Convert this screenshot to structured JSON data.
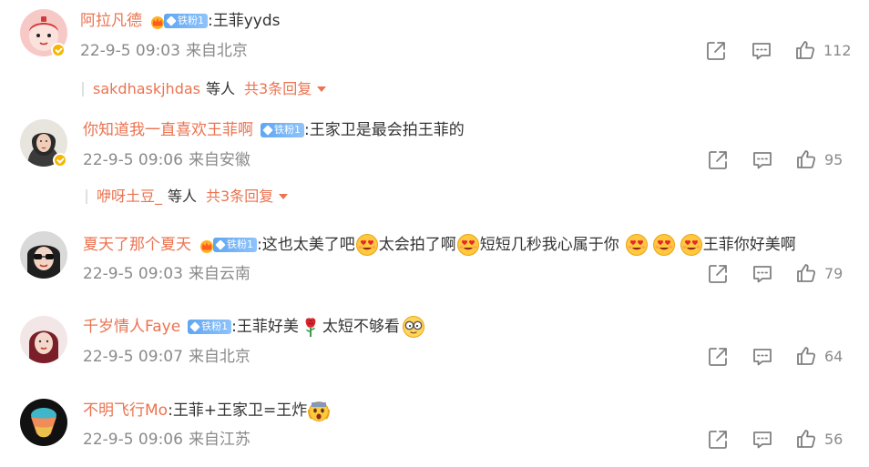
{
  "comments": [
    {
      "username": "阿拉凡德",
      "fan_badge": "铁粉1",
      "has_crown": true,
      "separator": ":",
      "text": "王菲yyds",
      "time": "22-9-5 09:03",
      "source": "来自北京",
      "likes": "112",
      "replies": {
        "users": "sakdhaskjhdas",
        "etc": "等人",
        "total": "共3条回复"
      }
    },
    {
      "username": "你知道我一直喜欢王菲啊",
      "fan_badge": "铁粉1",
      "has_crown": false,
      "separator": ":",
      "text": "王家卫是最会拍王菲的",
      "time": "22-9-5 09:06",
      "source": "来自安徽",
      "likes": "95",
      "replies": {
        "users": "咿呀土豆_",
        "etc": "等人",
        "total": "共3条回复"
      }
    },
    {
      "username": "夏天了那个夏天",
      "fan_badge": "铁粉1",
      "has_crown": true,
      "separator": ":",
      "text_parts": [
        "这也太美了吧",
        "太会拍了啊",
        "短短几秒我心属于你",
        "王菲你好美啊"
      ],
      "time": "22-9-5 09:03",
      "source": "来自云南",
      "likes": "79"
    },
    {
      "username": "千岁情人Faye",
      "fan_badge": "铁粉1",
      "has_crown": false,
      "separator": ":",
      "text_parts": [
        "王菲好美",
        "太短不够看"
      ],
      "time": "22-9-5 09:07",
      "source": "来自北京",
      "likes": "64"
    },
    {
      "username": "不明飞行Mo",
      "separator": ":",
      "text": "王菲+王家卫=王炸",
      "time": "22-9-5 09:06",
      "source": "来自江苏",
      "likes": "56"
    }
  ],
  "icons": {
    "share": "share-icon",
    "comment": "comment-icon",
    "like": "like-icon",
    "heart_eyes": "heart-eyes-emoji",
    "rose": "rose-emoji",
    "glasses": "glasses-emoji",
    "shocked": "shocked-emoji"
  },
  "colors": {
    "username": "#eb7350",
    "meta": "#8a8a8a",
    "badge": "#5ea6f3"
  }
}
